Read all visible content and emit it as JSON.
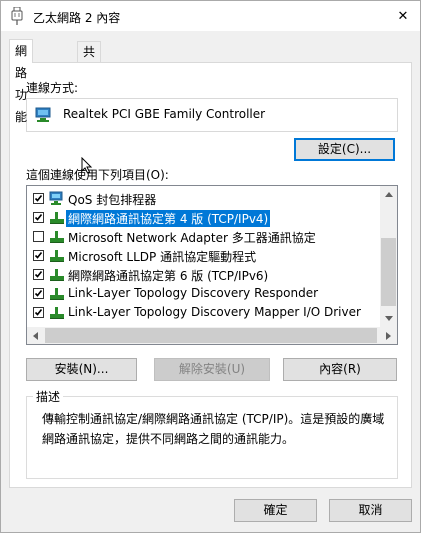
{
  "window": {
    "title": "乙太網路 2 內容",
    "close_glyph": "✕"
  },
  "tabs": [
    {
      "label": "網路功能",
      "active": true
    },
    {
      "label": "共用",
      "active": false
    }
  ],
  "connect_using": {
    "label": "連線方式:",
    "adapter_name": "Realtek PCI GBE Family Controller",
    "configure_button": "設定(C)..."
  },
  "items_section": {
    "label": "這個連線使用下列項目(O):",
    "items": [
      {
        "checked": true,
        "icon": "client-icon",
        "label": "QoS 封包排程器",
        "selected": false
      },
      {
        "checked": true,
        "icon": "protocol-icon",
        "label": "網際網路通訊協定第 4 版 (TCP/IPv4)",
        "selected": true
      },
      {
        "checked": false,
        "icon": "protocol-icon",
        "label": "Microsoft Network Adapter 多工器通訊協定",
        "selected": false
      },
      {
        "checked": true,
        "icon": "protocol-icon",
        "label": "Microsoft LLDP 通訊協定驅動程式",
        "selected": false
      },
      {
        "checked": true,
        "icon": "protocol-icon",
        "label": "網際網路通訊協定第 6 版 (TCP/IPv6)",
        "selected": false
      },
      {
        "checked": true,
        "icon": "protocol-icon",
        "label": "Link-Layer Topology Discovery Responder",
        "selected": false
      },
      {
        "checked": true,
        "icon": "protocol-icon",
        "label": "Link-Layer Topology Discovery Mapper I/O Driver",
        "selected": false
      }
    ]
  },
  "item_buttons": {
    "install": "安裝(N)...",
    "uninstall": "解除安裝(U)",
    "properties": "內容(R)"
  },
  "description": {
    "title": "描述",
    "text": "傳輸控制通訊協定/網際網路通訊協定 (TCP/IP)。這是預設的廣域網路通訊協定，提供不同網路之間的通訊能力。"
  },
  "footer": {
    "ok": "確定",
    "cancel": "取消"
  },
  "colors": {
    "accent": "#0078d7",
    "window_bg": "#f0f0f0"
  }
}
